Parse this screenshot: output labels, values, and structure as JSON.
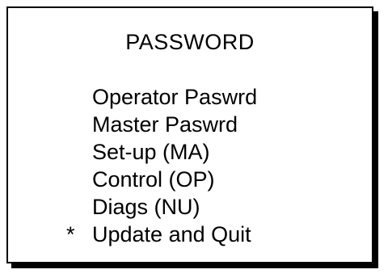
{
  "screen": {
    "title": "PASSWORD"
  },
  "menu": {
    "cursor_symbol": "*",
    "selected_index": 5,
    "items": [
      {
        "label": "Operator Paswrd"
      },
      {
        "label": "Master Paswrd"
      },
      {
        "label": "Set-up (MA)"
      },
      {
        "label": "Control (OP)"
      },
      {
        "label": "Diags (NU)"
      },
      {
        "label": "Update and Quit"
      }
    ]
  }
}
